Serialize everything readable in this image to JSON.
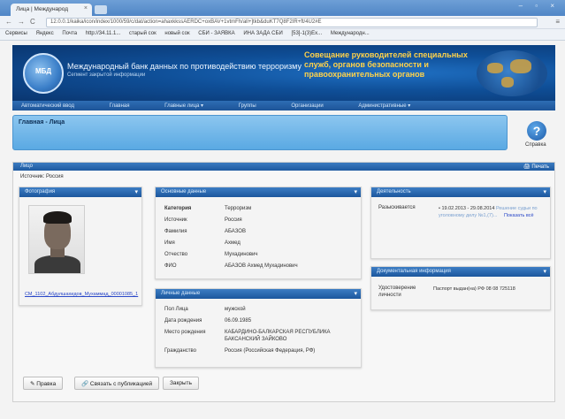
{
  "browser": {
    "tab_title": "Лица | Международ",
    "tab_close": "×",
    "window_controls": "– ▫ ×",
    "nav": [
      "←",
      "→",
      "C"
    ],
    "url": "12.0.0.1/kaika/icon/index/1000/59/c/dat/action=ahaxkkssAERDC+oxBAV+1vtmFh/all+]tkb&duKT7Q8F2IR+ft/4U2#E",
    "menu": "≡",
    "bookmarks": [
      "Сервисы",
      "Яндекс",
      "Почта",
      "http://34.11.1...",
      "старый сок",
      "новый сок",
      "СБИ - ЗАЯВКА",
      "ИНА ЗАДА СБИ",
      "[53]-1(3)Ex...",
      "Международн..."
    ]
  },
  "site": {
    "logo_text": "МБД",
    "title": "Международный банк данных по противодействию терроризму",
    "subtitle": "Сегмент закрытой информации",
    "council": "Совещание руководителей специальных служб, органов безопасности и правоохранительных органов",
    "nav": [
      "Автоматический ввод",
      "Главная",
      "Главные лица ▾",
      "Группы",
      "Организации",
      "Административные ▾"
    ]
  },
  "page": {
    "breadcrumb": "Главная - Лица",
    "help_label": "Справка",
    "card_title": "Лицо",
    "print_label": "Печать",
    "source": "Источник: Россия"
  },
  "photo_panel": {
    "title": "Фотография",
    "link": "СМ_1102_Абдулшахидов_Мухаммад_00001085_1"
  },
  "basic_panel": {
    "title": "Основные данные",
    "rows": [
      {
        "k": "Категория",
        "v": "Терроризм"
      },
      {
        "k": "Источник",
        "v": "Россия"
      },
      {
        "k": "Фамилия",
        "v": "АБАЗОВ"
      },
      {
        "k": "Имя",
        "v": "Ахмед"
      },
      {
        "k": "Отчество",
        "v": "Мухадинович"
      },
      {
        "k": "ФИО",
        "v": "АБАЗОВ Ахмед Мухадинович"
      }
    ]
  },
  "personal_panel": {
    "title": "Личные данные",
    "rows": [
      {
        "k": "Пол Лица",
        "v": "мужской"
      },
      {
        "k": "Дата рождения",
        "v": "06.09.1985"
      },
      {
        "k": "Место рождения",
        "v": "КАБАРДИНО-БАЛКАРСКАЯ РЕСПУБЛИКА БАКСАНСКИЙ ЗАЙКОВО"
      },
      {
        "k": "Гражданство",
        "v": "Россия (Российская Федерация, РФ)"
      }
    ]
  },
  "activity_panel": {
    "title": "Деятельность",
    "label": "Разыскивается",
    "date_range": "• 19.02.2013 - 29.08.2014",
    "detail": "Решение судьи по уголовному делу №1,(7)...",
    "more": "Показать всё"
  },
  "docs_panel": {
    "title": "Документальная информация",
    "label": "Удостоверение личности",
    "value": "Паспорт выдан(на) РФ 08 08 725118"
  },
  "buttons": {
    "edit": "Правка",
    "link_pub": "Связать с публикацией",
    "close": "Закрыть"
  }
}
